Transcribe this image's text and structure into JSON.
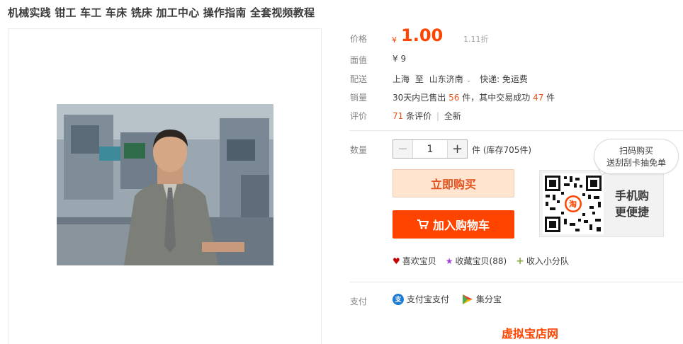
{
  "product": {
    "title": "机械实践 钳工 车工 车床 铣床 加工中心 操作指南 全套视频教程"
  },
  "price": {
    "label": "价格",
    "currency": "¥",
    "value": "1.00",
    "discount": "1.11折"
  },
  "face_value": {
    "label": "面值",
    "value": "¥ 9"
  },
  "delivery": {
    "label": "配送",
    "from": "上海",
    "to_word": "至",
    "to": "山东济南",
    "express": "快递: 免运费"
  },
  "sales": {
    "label": "销量",
    "prefix": "30天内已售出",
    "sold": "56",
    "mid": "件，其中交易成功",
    "success": "47",
    "suffix": "件"
  },
  "reviews": {
    "label": "评价",
    "count": "71",
    "unit": "条评价",
    "separator": "|",
    "badge": "全新"
  },
  "quantity": {
    "label": "数量",
    "minus": "−",
    "value": "1",
    "plus": "+",
    "stock": "件 (库存705件)"
  },
  "buttons": {
    "buy_now": "立即购买",
    "add_cart": "加入购物车"
  },
  "mobile": {
    "bubble_line1": "扫码购买",
    "bubble_line2": "送刮刮卡抽免单",
    "line1": "手机购",
    "line2": "更便捷",
    "qr_badge": "淘"
  },
  "actions": [
    {
      "icon": "heart-icon",
      "label": "喜欢宝贝",
      "color": "#c40000"
    },
    {
      "icon": "star-icon",
      "label": "收藏宝贝(88)",
      "color": "#a03fd8"
    },
    {
      "icon": "plus-icon",
      "label": "收入小分队",
      "color": "#8aa844"
    }
  ],
  "payment": {
    "label": "支付",
    "methods": [
      {
        "icon": "alipay-icon",
        "label": "支付宝支付",
        "icon_text": "支",
        "color": "#1c7bd5"
      },
      {
        "icon": "jifenbao-icon",
        "label": "集分宝",
        "icon_text": "",
        "color": "#f2b705"
      }
    ]
  },
  "cut_text": "虚拟宝店网"
}
